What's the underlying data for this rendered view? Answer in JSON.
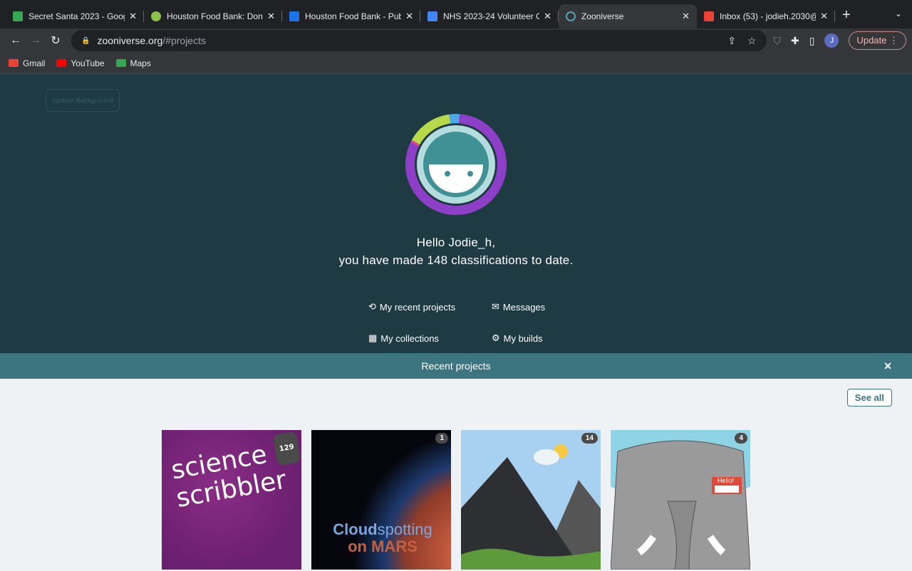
{
  "browser": {
    "tabs": [
      {
        "title": "Secret Santa 2023 - Google",
        "color": "#34a853"
      },
      {
        "title": "Houston Food Bank: Donat",
        "color": "#8bc34a"
      },
      {
        "title": "Houston Food Bank - Publi",
        "color": "#1a73e8"
      },
      {
        "title": "NHS 2023-24 Volunteer O",
        "color": "#4285f4"
      },
      {
        "title": "Zooniverse",
        "color": "#5aa0b8"
      },
      {
        "title": "Inbox (53) - jodieh.2030@",
        "color": "#ea4335"
      }
    ],
    "url_domain": "zooniverse.org",
    "url_path": "/#projects",
    "profile_initial": "J",
    "update_label": "Update",
    "bookmarks": [
      {
        "label": "Gmail",
        "color": "#ea4335"
      },
      {
        "label": "YouTube",
        "color": "#ff0000"
      },
      {
        "label": "Maps",
        "color": "#34a853"
      }
    ]
  },
  "hero": {
    "update_background": "Update Background",
    "greeting": "Hello Jodie_h,",
    "summary": "you have made 148 classifications to date.",
    "links": {
      "recent": "My recent projects",
      "messages": "Messages",
      "collections": "My collections",
      "builds": "My builds"
    }
  },
  "recent": {
    "title": "Recent projects",
    "see_all": "See all",
    "projects": [
      {
        "count": "129",
        "art": "science scribbler"
      },
      {
        "count": "1",
        "art_a": "Cloud",
        "art_b": "spotting",
        "art_c": "on MARS"
      },
      {
        "count": "14"
      },
      {
        "count": "4",
        "sign": "Hello!"
      }
    ]
  }
}
